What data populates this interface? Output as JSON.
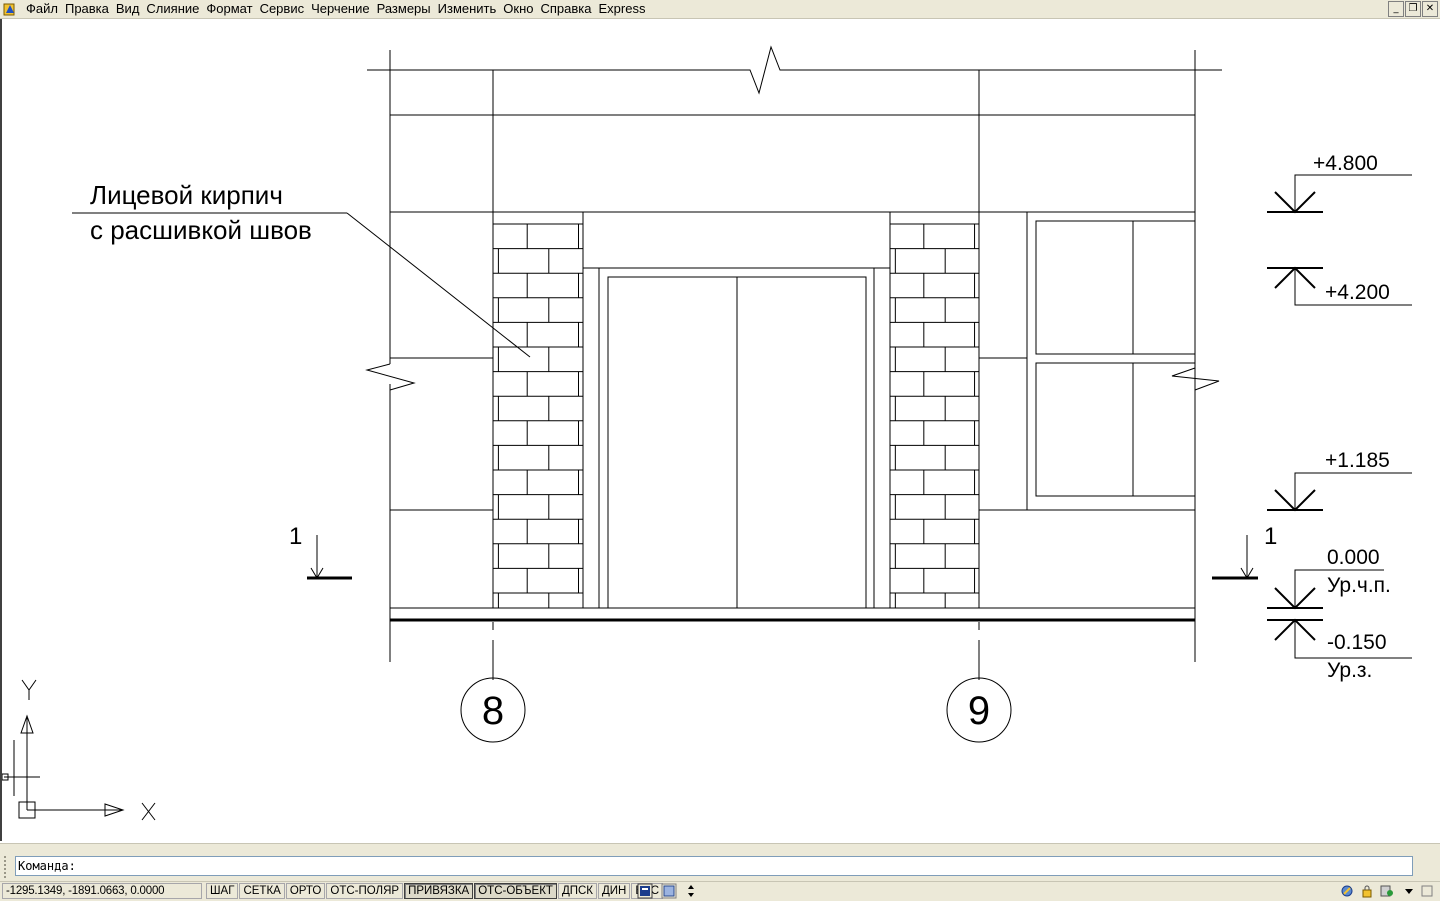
{
  "menu": {
    "items": [
      "Файл",
      "Правка",
      "Вид",
      "Слияние",
      "Формат",
      "Сервис",
      "Черчение",
      "Размеры",
      "Изменить",
      "Окно",
      "Справка",
      "Express"
    ],
    "window_controls": [
      "minimize",
      "restore",
      "close"
    ]
  },
  "drawing": {
    "note": [
      "Лицевой кирпич",
      "с расшивкой швов"
    ],
    "levels": [
      {
        "value": "+4.800",
        "sub": ""
      },
      {
        "value": "+4.200",
        "sub": ""
      },
      {
        "value": "+1.185",
        "sub": ""
      },
      {
        "value": "0.000",
        "sub": "Ур.ч.п."
      },
      {
        "value": "-0.150",
        "sub": "Ур.з."
      }
    ],
    "axes": [
      "8",
      "9"
    ],
    "section_marks": [
      "1",
      "1"
    ],
    "ucs": {
      "x": "X",
      "y": "Y"
    }
  },
  "command": {
    "prompt": "Команда:"
  },
  "status": {
    "coords": "-1295.1349, -1891.0663, 0.0000",
    "toggles": [
      {
        "label": "ШАГ",
        "on": false
      },
      {
        "label": "СЕТКА",
        "on": false
      },
      {
        "label": "ОРТО",
        "on": false
      },
      {
        "label": "ОТС-ПОЛЯР",
        "on": false
      },
      {
        "label": "ПРИВЯЗКА",
        "on": true
      },
      {
        "label": "ОТС-ОБЪЕКТ",
        "on": true
      },
      {
        "label": "ДПСК",
        "on": false
      },
      {
        "label": "ДИН",
        "on": false
      },
      {
        "label": "ВЕС",
        "on": false
      }
    ]
  }
}
